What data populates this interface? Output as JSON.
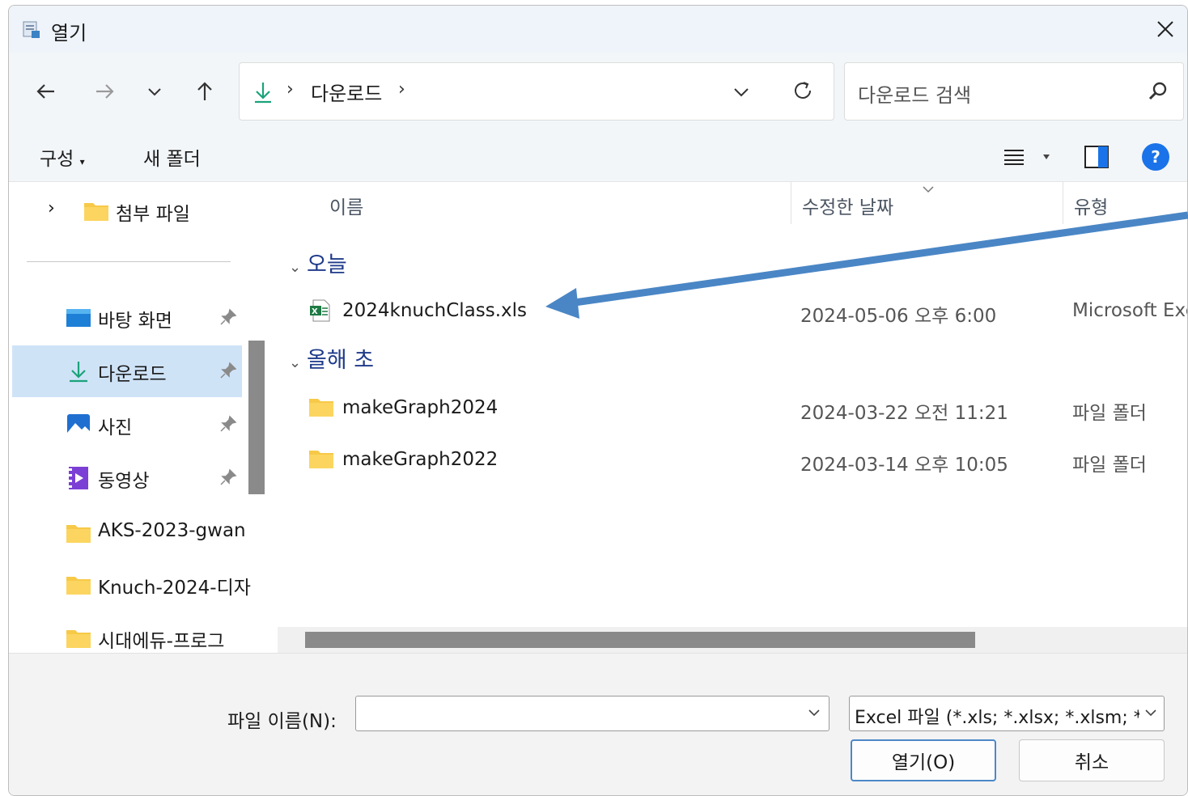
{
  "window": {
    "title": "열기"
  },
  "address": {
    "location": "다운로드"
  },
  "search": {
    "placeholder": "다운로드 검색"
  },
  "toolbar": {
    "organize": "구성",
    "new_folder": "새 폴더",
    "help": "?"
  },
  "sidebar": {
    "tree_item": "첨부 파일",
    "quick_access": [
      {
        "label": "바탕 화면",
        "icon": "desktop-icon",
        "pinned": true
      },
      {
        "label": "다운로드",
        "icon": "download-icon",
        "pinned": true,
        "selected": true
      },
      {
        "label": "사진",
        "icon": "pictures-icon",
        "pinned": true
      },
      {
        "label": "동영상",
        "icon": "videos-icon",
        "pinned": true
      },
      {
        "label": "AKS-2023-gwan",
        "icon": "folder-icon"
      },
      {
        "label": "Knuch-2024-디자",
        "icon": "folder-icon"
      },
      {
        "label": "시대에듀-프로그",
        "icon": "folder-icon"
      }
    ]
  },
  "columns": {
    "name": "이름",
    "modified": "수정한 날짜",
    "type": "유형"
  },
  "groups": [
    {
      "label": "오늘",
      "files": [
        {
          "name": "2024knuchClass.xls",
          "modified": "2024-05-06 오후 6:00",
          "type": "Microsoft Exc",
          "icon": "excel-file-icon"
        }
      ]
    },
    {
      "label": "올해 초",
      "files": [
        {
          "name": "makeGraph2024",
          "modified": "2024-03-22 오전 11:21",
          "type": "파일 폴더",
          "icon": "folder-icon"
        },
        {
          "name": "makeGraph2022",
          "modified": "2024-03-14 오후 10:05",
          "type": "파일 폴더",
          "icon": "folder-icon"
        }
      ]
    }
  ],
  "footer": {
    "filename_label": "파일 이름(N):",
    "filename_value": "",
    "filetype": "Excel 파일 (*.xls; *.xlsx; *.xlsm; *.",
    "open_button": "열기(O)",
    "cancel_button": "취소"
  },
  "colors": {
    "accent": "#1a73e8",
    "selected": "#cfe3f7",
    "annotation_arrow": "#4a86c5",
    "group_header": "#1e3a8a"
  }
}
